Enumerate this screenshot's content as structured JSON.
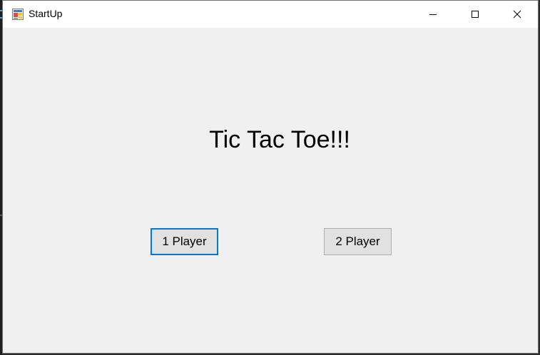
{
  "window": {
    "title": "StartUp",
    "app_icon": "winforms-app-icon",
    "caption_buttons": {
      "minimize_icon": "minimize-icon",
      "maximize_icon": "maximize-icon",
      "close_icon": "close-icon"
    }
  },
  "main": {
    "heading": "Tic Tac Toe!!!",
    "buttons": {
      "one_player": "1 Player",
      "two_player": "2 Player"
    }
  },
  "colors": {
    "client_bg": "#f0f0f0",
    "titlebar_bg": "#ffffff",
    "focus_accent": "#0078d7",
    "button_bg": "#e1e1e1",
    "button_border": "#adadad"
  }
}
